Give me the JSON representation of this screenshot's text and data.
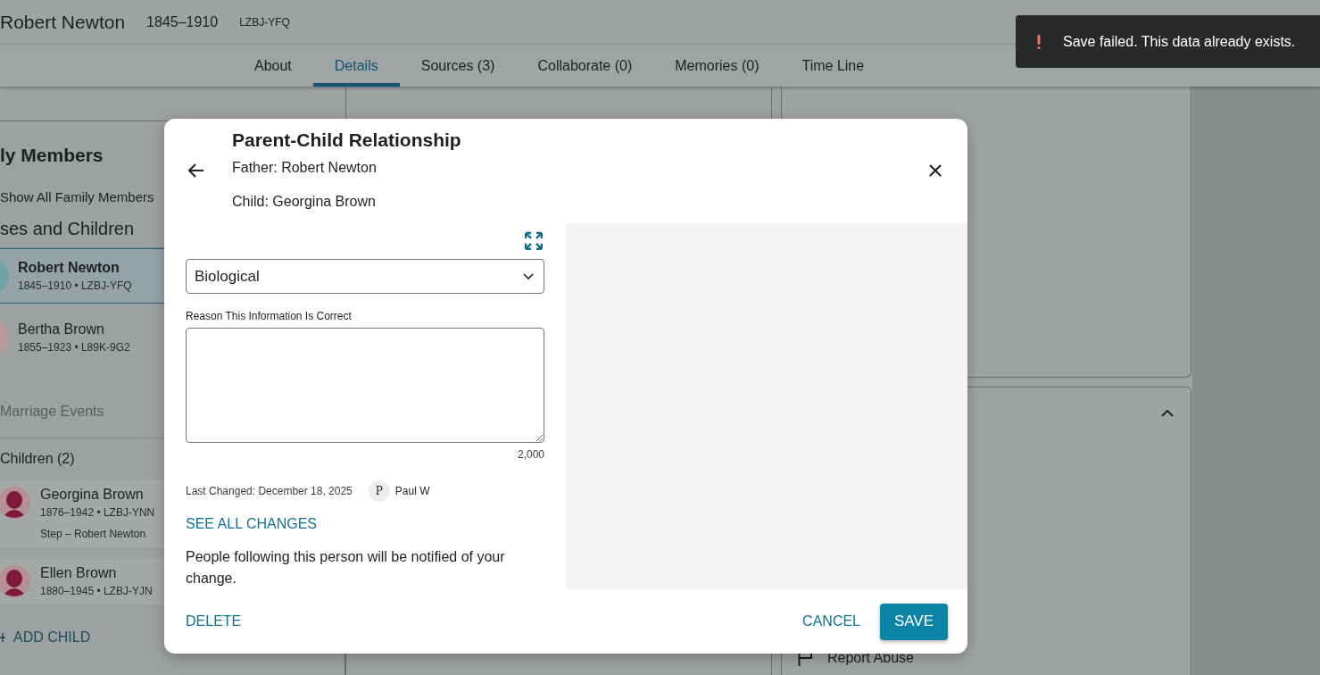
{
  "header": {
    "name": "Robert Newton",
    "dates": "1845–1910",
    "id": "LZBJ-YFQ"
  },
  "tabs": [
    {
      "label": "About",
      "selected": false
    },
    {
      "label": "Details",
      "selected": true
    },
    {
      "label": "Sources (3)",
      "selected": false
    },
    {
      "label": "Collaborate (0)",
      "selected": false
    },
    {
      "label": "Memories (0)",
      "selected": false
    },
    {
      "label": "Time Line",
      "selected": false
    }
  ],
  "family_panel": {
    "title": "ly Members",
    "show_all": "Show All Family Members",
    "section_title": "ses and Children",
    "spouses": [
      {
        "name": "Robert Newton",
        "details": "1845–1910 • LZBJ-YFQ",
        "selected": true,
        "color": "#6fa3a8"
      },
      {
        "name": "Bertha Brown",
        "details": "1855–1923 • L89K-9G2",
        "selected": false,
        "color": "#b89a9c"
      }
    ],
    "marriage_events": {
      "label": "Marriage Events",
      "disabled": true
    },
    "children_heading": "Children (2)",
    "children": [
      {
        "name": "Georgina Brown",
        "details": "1876–1942 • LZBJ-YNN",
        "relationship": "Step – Robert Newton"
      },
      {
        "name": "Ellen Brown",
        "details": "1880–1945 • LZBJ-YJN"
      }
    ],
    "add_child": "ADD CHILD"
  },
  "side_panel": {
    "report_label": "Report Abuse"
  },
  "modal": {
    "title": "Parent-Child Relationship",
    "father": "Father: Robert Newton",
    "child": "Child: Georgina Brown",
    "relationship_type": "Biological",
    "reason_label": "Reason This Information Is Correct",
    "char_count": "2,000",
    "last_changed": "Last Changed: December 18, 2025",
    "changed_by": {
      "initial": "P",
      "name": "Paul W"
    },
    "see_all_changes": "SEE ALL CHANGES",
    "notice": "People following this person will be notified of your change.",
    "delete": "DELETE",
    "cancel": "CANCEL",
    "save": "SAVE"
  },
  "toast": {
    "kind": "error",
    "message": "Save failed. This data already exists."
  }
}
